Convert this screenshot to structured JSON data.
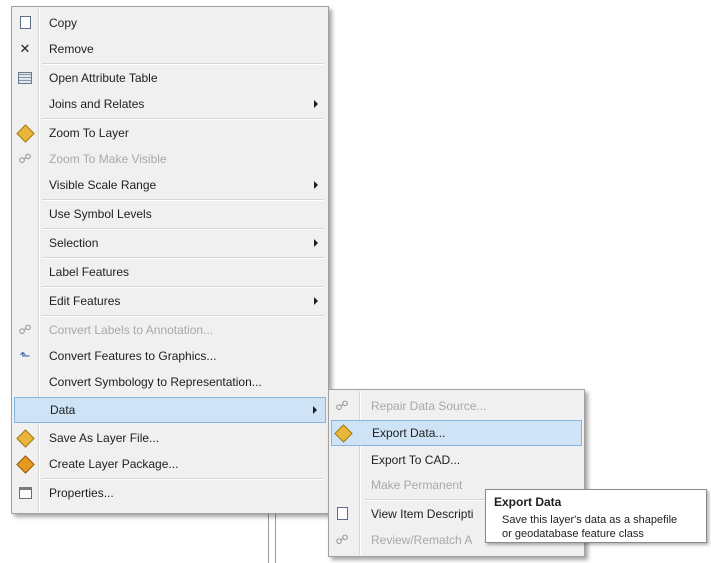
{
  "context_menu": {
    "items": [
      {
        "label": "Copy",
        "icon": "copy-icon",
        "glyph": "",
        "enabled": true,
        "submenu": false
      },
      {
        "label": "Remove",
        "icon": "remove-icon",
        "glyph": "✕",
        "enabled": true,
        "submenu": false
      },
      {
        "label": "Open Attribute Table",
        "icon": "attribute-table-icon",
        "glyph": "",
        "enabled": true,
        "submenu": false
      },
      {
        "label": "Joins and Relates",
        "icon": "",
        "glyph": "",
        "enabled": true,
        "submenu": true
      },
      {
        "label": "Zoom To Layer",
        "icon": "zoom-to-layer-icon",
        "glyph": "",
        "enabled": true,
        "submenu": false
      },
      {
        "label": "Zoom To Make Visible",
        "icon": "zoom-visible-icon",
        "glyph": "☍",
        "enabled": false,
        "submenu": false
      },
      {
        "label": "Visible Scale Range",
        "icon": "",
        "glyph": "",
        "enabled": true,
        "submenu": true
      },
      {
        "label": "Use Symbol Levels",
        "icon": "",
        "glyph": "",
        "enabled": true,
        "submenu": false
      },
      {
        "label": "Selection",
        "icon": "",
        "glyph": "",
        "enabled": true,
        "submenu": true
      },
      {
        "label": "Label Features",
        "icon": "",
        "glyph": "",
        "enabled": true,
        "submenu": false
      },
      {
        "label": "Edit Features",
        "icon": "",
        "glyph": "",
        "enabled": true,
        "submenu": true
      },
      {
        "label": "Convert Labels to Annotation...",
        "icon": "convert-labels-icon",
        "glyph": "☍",
        "enabled": false,
        "submenu": false
      },
      {
        "label": "Convert Features to Graphics...",
        "icon": "convert-graphics-icon",
        "glyph": "⬑",
        "enabled": true,
        "submenu": false
      },
      {
        "label": "Convert Symbology to Representation...",
        "icon": "",
        "glyph": "",
        "enabled": true,
        "submenu": false
      },
      {
        "label": "Data",
        "icon": "",
        "glyph": "",
        "enabled": true,
        "submenu": true,
        "highlighted": true
      },
      {
        "label": "Save As Layer File...",
        "icon": "layer-file-icon",
        "glyph": "",
        "enabled": true,
        "submenu": false
      },
      {
        "label": "Create Layer Package...",
        "icon": "layer-package-icon",
        "glyph": "",
        "enabled": true,
        "submenu": false
      },
      {
        "label": "Properties...",
        "icon": "properties-icon",
        "glyph": "",
        "enabled": true,
        "submenu": false
      }
    ]
  },
  "data_submenu": {
    "items": [
      {
        "label": "Repair Data Source...",
        "icon": "repair-source-icon",
        "glyph": "☍",
        "enabled": false
      },
      {
        "label": "Export Data...",
        "icon": "export-data-icon",
        "glyph": "",
        "enabled": true,
        "highlighted": true
      },
      {
        "label": "Export To CAD...",
        "icon": "",
        "glyph": "",
        "enabled": true
      },
      {
        "label": "Make Permanent",
        "icon": "",
        "glyph": "",
        "enabled": false
      },
      {
        "label": "View Item Descripti",
        "icon": "item-description-icon",
        "glyph": "",
        "enabled": true
      },
      {
        "label": "Review/Rematch A",
        "icon": "review-rematch-icon",
        "glyph": "☍",
        "enabled": false
      }
    ]
  },
  "tooltip": {
    "title": "Export Data",
    "line1": "Save this layer's data as a shapefile",
    "line2": "or geodatabase feature class"
  },
  "colors": {
    "menu_bg": "#f0f0f0",
    "highlight_bg": "#cfe3f6",
    "highlight_border": "#86b6e0",
    "disabled_text": "#a8a8a8"
  }
}
